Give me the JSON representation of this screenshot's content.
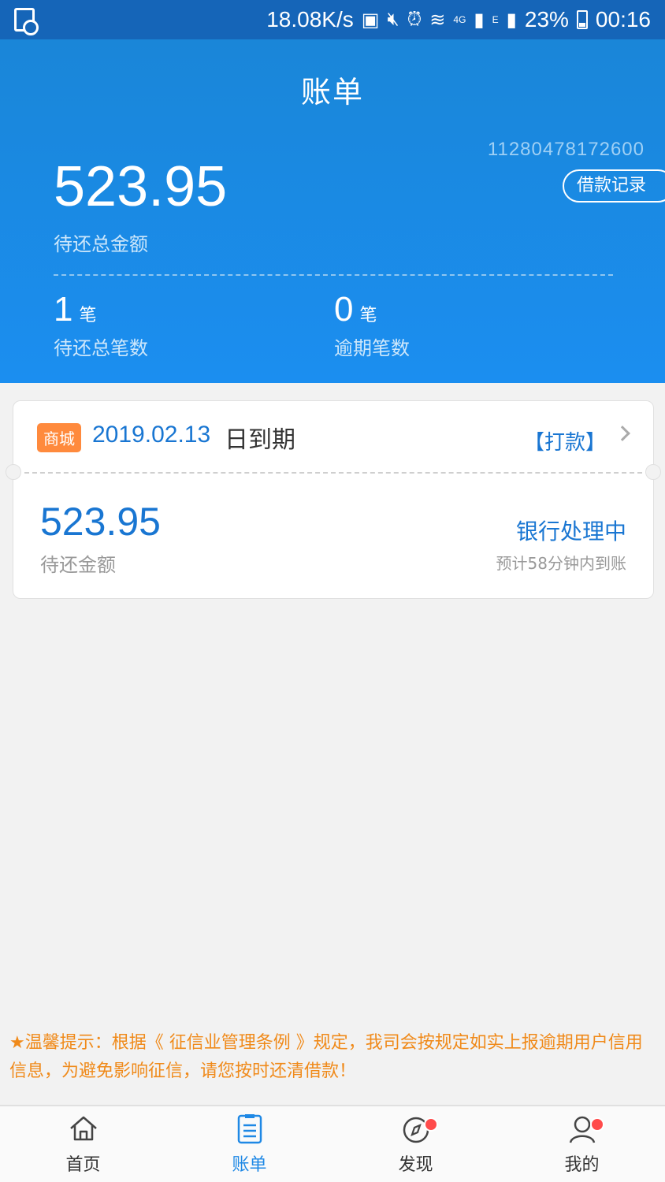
{
  "status_bar": {
    "speed": "18.08K/s",
    "net1": "4G",
    "net2": "E",
    "battery": "23%",
    "time": "00:16"
  },
  "header": {
    "title": "账单",
    "account_no": "11280478172600",
    "record_button": "借款记录",
    "total_amount": "523.95",
    "total_label": "待还总金额",
    "pending_count": "1",
    "pending_unit": "笔",
    "pending_label": "待还总笔数",
    "overdue_count": "0",
    "overdue_unit": "笔",
    "overdue_label": "逾期笔数"
  },
  "bill": {
    "tag": "商城",
    "due_date": "2019.02.13",
    "due_suffix": "日到期",
    "pay_link": "【打款】",
    "amount": "523.95",
    "amount_label": "待还金额",
    "status": "银行处理中",
    "eta": "预计58分钟内到账"
  },
  "notice": "★温馨提示：根据《 征信业管理条例 》规定，我司会按规定如实上报逾期用户信用信息，为避免影响征信，请您按时还清借款！",
  "tabs": [
    {
      "label": "首页",
      "icon": "home-icon"
    },
    {
      "label": "账单",
      "icon": "bill-icon"
    },
    {
      "label": "发现",
      "icon": "compass-icon"
    },
    {
      "label": "我的",
      "icon": "user-icon"
    }
  ],
  "colors": {
    "primary": "#1b8ef0",
    "accent_orange": "#f08a1a",
    "tag_orange": "#ff8a3d",
    "link_blue": "#1976d2",
    "badge_red": "#ff4b4b"
  }
}
